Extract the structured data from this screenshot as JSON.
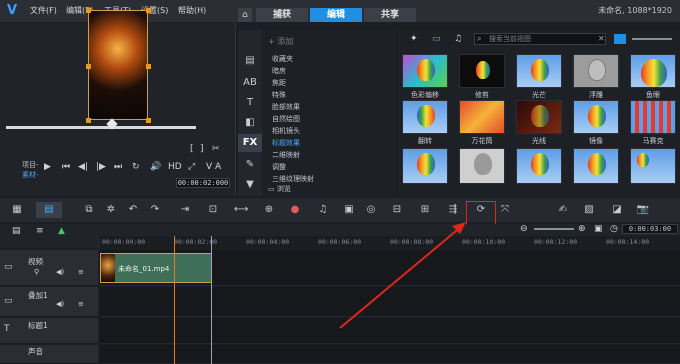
{
  "app": {
    "menus": [
      "文件(F)",
      "编辑(E)",
      "工具(T)",
      "设置(S)",
      "帮助(H)"
    ],
    "tabs": [
      {
        "label": "捕获",
        "active": false
      },
      {
        "label": "编辑",
        "active": true
      },
      {
        "label": "共享",
        "active": false
      }
    ],
    "project_title": "未命名, 1088*1920",
    "accent_color": "#1f8fe3"
  },
  "preview": {
    "project_label": "项目-",
    "clip_label": "素材-",
    "timecode": "00:00:02:000",
    "va_label": "V A"
  },
  "library": {
    "add_label": "添加",
    "categories": [
      "收藏夹",
      "暗房",
      "焦距",
      "特殊",
      "脸部效果",
      "自然绘图",
      "相机镜头",
      "标题效果",
      "二维映射",
      "调整",
      "三维纹理映射"
    ],
    "selected_category": "标题效果",
    "browse_label": "浏览",
    "search_placeholder": "搜索当前视图",
    "side_icons": [
      "media-icon",
      "transition-icon",
      "title-icon",
      "graphic-icon",
      "fx-icon",
      "path-icon"
    ],
    "fx_label": "FX"
  },
  "effects": {
    "row1": [
      "色彩偏移",
      "修剪",
      "光芒",
      "浮雕",
      "鱼眼"
    ],
    "row2": [
      "翻转",
      "万花筒",
      "光线",
      "镜像",
      "马赛克"
    ]
  },
  "timeline": {
    "ruler_ticks": [
      "00:00:00:00",
      "00:00:02:00",
      "00:00:04:00",
      "00:00:06:00",
      "00:00:08:00",
      "00:00:10:00",
      "00:00:12:00",
      "00:00:14:00"
    ],
    "zoom_timecode": "0:00:03:00",
    "tracks": [
      {
        "name": "视频",
        "icon": "video-track-icon"
      },
      {
        "name": "叠加1",
        "icon": "overlay-track-icon"
      },
      {
        "name": "标题1",
        "icon": "title-track-icon"
      },
      {
        "name": "声音",
        "icon": "voice-track-icon"
      }
    ],
    "clip_name": "未命名_01.mp4"
  }
}
